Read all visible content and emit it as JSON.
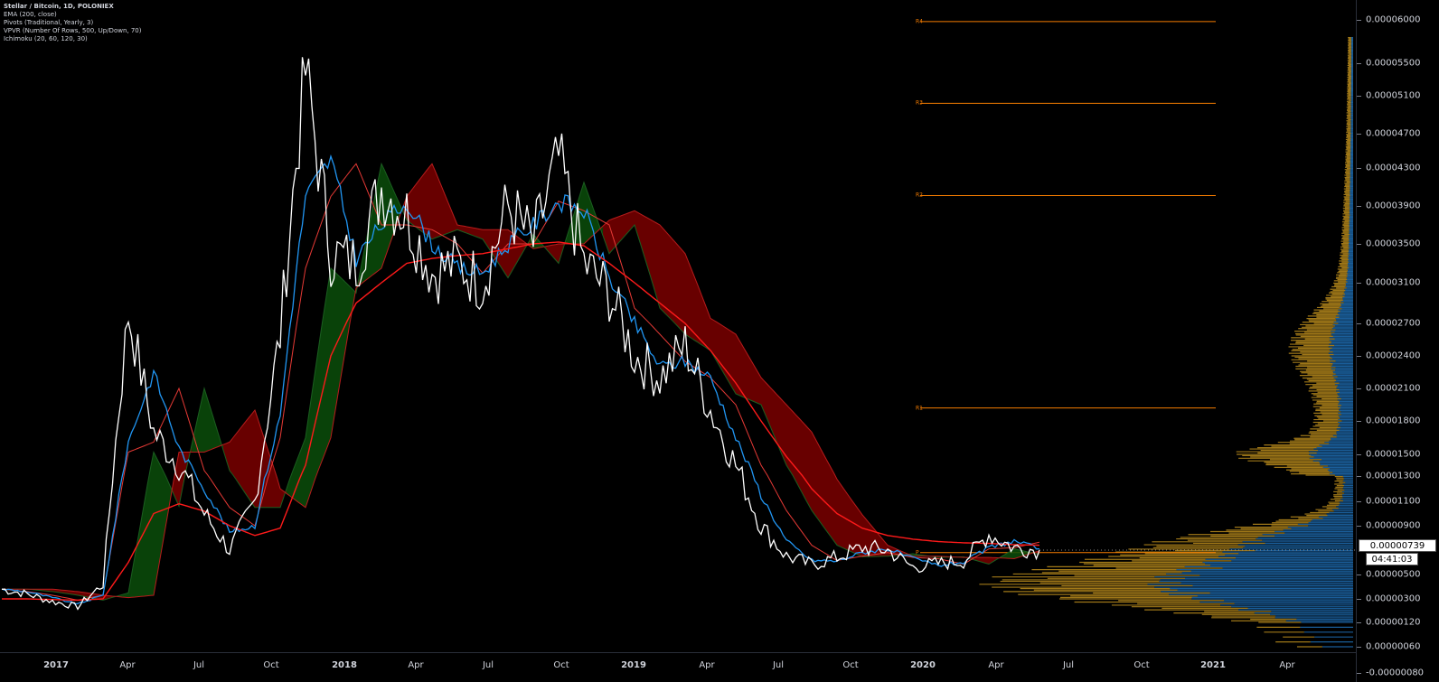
{
  "legend": {
    "title": "Stellar / Bitcoin, 1D, POLONIEX",
    "indicators": [
      "EMA (200, close)",
      "Pivots (Traditional, Yearly, 3)",
      "VPVR (Number Of Rows, 500, Up/Down, 70)",
      "Ichimoku (20, 60, 120, 30)"
    ]
  },
  "colors": {
    "background": "#000000",
    "price_line": "#ffffff",
    "ema": "#ff1a1a",
    "conversion": "#2196f3",
    "base": "#b71c1c",
    "lagging": "#1b5e20",
    "cloud_bear": "#7a0000",
    "cloud_bull": "#0b4d0b",
    "pivot": "#f57c00",
    "vp_up": "#1e6fb5",
    "vp_down": "#c8961e"
  },
  "price_axis": {
    "labels": [
      {
        "text": "0.00006000",
        "value": 6000
      },
      {
        "text": "0.00005500",
        "value": 5500
      },
      {
        "text": "0.00005100",
        "value": 5100
      },
      {
        "text": "0.00004700",
        "value": 4700
      },
      {
        "text": "0.00004300",
        "value": 4300
      },
      {
        "text": "0.00003900",
        "value": 3900
      },
      {
        "text": "0.00003500",
        "value": 3500
      },
      {
        "text": "0.00003100",
        "value": 3100
      },
      {
        "text": "0.00002700",
        "value": 2700
      },
      {
        "text": "0.00002400",
        "value": 2400
      },
      {
        "text": "0.00002100",
        "value": 2100
      },
      {
        "text": "0.00001800",
        "value": 1800
      },
      {
        "text": "0.00001500",
        "value": 1500
      },
      {
        "text": "0.00001300",
        "value": 1300
      },
      {
        "text": "0.00001100",
        "value": 1100
      },
      {
        "text": "0.00000900",
        "value": 900
      },
      {
        "text": "0.00000500",
        "value": 500
      },
      {
        "text": "0.00000300",
        "value": 300
      },
      {
        "text": "0.00000120",
        "value": 120
      },
      {
        "text": "0.00000060",
        "value": 60
      },
      {
        "text": "-0.00000080",
        "value": -80
      }
    ],
    "current_price": "0.00000739",
    "countdown": "04:41:03"
  },
  "time_axis": {
    "labels": [
      {
        "text": "2017",
        "major": true
      },
      {
        "text": "Apr",
        "major": false
      },
      {
        "text": "Jul",
        "major": false
      },
      {
        "text": "Oct",
        "major": false
      },
      {
        "text": "2018",
        "major": true
      },
      {
        "text": "Apr",
        "major": false
      },
      {
        "text": "Jul",
        "major": false
      },
      {
        "text": "Oct",
        "major": false
      },
      {
        "text": "2019",
        "major": true
      },
      {
        "text": "Apr",
        "major": false
      },
      {
        "text": "Jul",
        "major": false
      },
      {
        "text": "Oct",
        "major": false
      },
      {
        "text": "2020",
        "major": true
      },
      {
        "text": "Apr",
        "major": false
      },
      {
        "text": "Jul",
        "major": false
      },
      {
        "text": "Oct",
        "major": false
      },
      {
        "text": "2021",
        "major": true
      },
      {
        "text": "Apr",
        "major": false
      }
    ]
  },
  "pivots": [
    {
      "label": "R4",
      "value": 5980
    },
    {
      "label": "R3",
      "value": 5020
    },
    {
      "label": "R2",
      "value": 4010
    },
    {
      "label": "R1",
      "value": 1920
    },
    {
      "label": "P",
      "value": 680
    }
  ],
  "chart_data": {
    "type": "line",
    "x": [
      "2017-01",
      "2017-02",
      "2017-03",
      "2017-04",
      "2017-05",
      "2017-06",
      "2017-07",
      "2017-08",
      "2017-09",
      "2017-10",
      "2017-11",
      "2017-12",
      "2018-01",
      "2018-02",
      "2018-03",
      "2018-04",
      "2018-05",
      "2018-06",
      "2018-07",
      "2018-08",
      "2018-09",
      "2018-10",
      "2018-11",
      "2018-12",
      "2019-01",
      "2019-02",
      "2019-03",
      "2019-04",
      "2019-05",
      "2019-06",
      "2019-07",
      "2019-08",
      "2019-09",
      "2019-10",
      "2019-11",
      "2019-12",
      "2020-01",
      "2020-02",
      "2020-03",
      "2020-04",
      "2020-05",
      "2020-06"
    ],
    "series": [
      {
        "values": [
          380,
          340,
          280,
          240,
          420,
          2800,
          1700,
          1400,
          1000,
          700,
          1100,
          2600,
          5400,
          3400,
          3300,
          4100,
          3800,
          3200,
          3300,
          3100,
          3900,
          3500,
          4400,
          3300,
          3000,
          2400,
          2200,
          2500,
          1900,
          1400,
          900,
          650,
          580,
          640,
          720,
          700,
          560,
          590,
          610,
          830,
          720,
          700
        ]
      },
      {
        "name": "EMA (200, close)",
        "values": [
          300,
          300,
          295,
          290,
          300,
          600,
          1000,
          1080,
          1020,
          900,
          820,
          880,
          1400,
          2400,
          2900,
          3100,
          3300,
          3350,
          3380,
          3400,
          3450,
          3500,
          3520,
          3480,
          3300,
          3100,
          2900,
          2700,
          2450,
          2150,
          1800,
          1480,
          1200,
          1000,
          880,
          820,
          790,
          770,
          760,
          755,
          745,
          740
        ]
      }
    ],
    "ylim": [
      -80,
      6200
    ]
  }
}
